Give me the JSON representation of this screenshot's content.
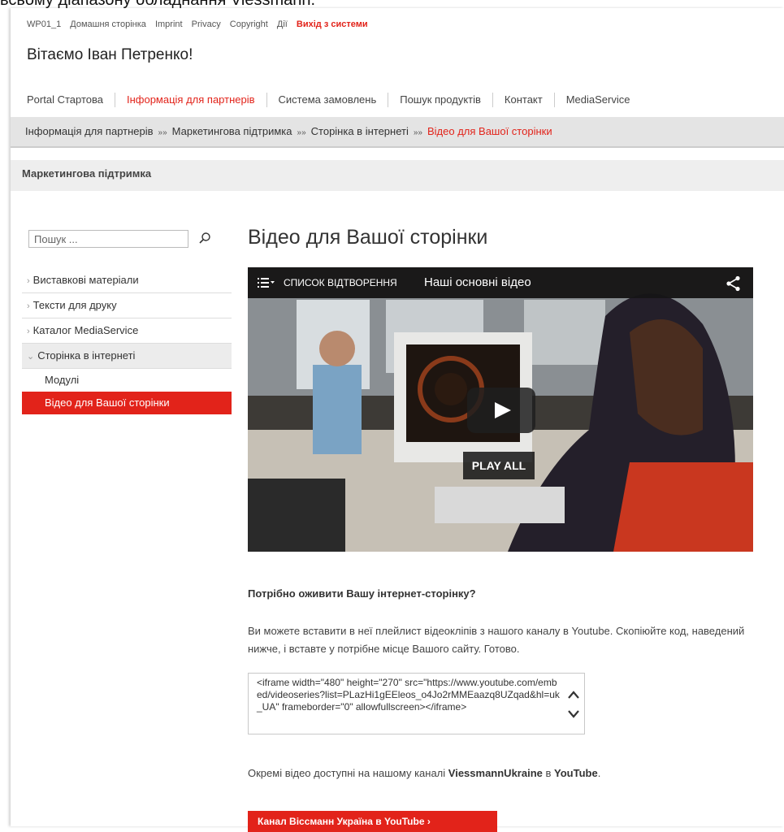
{
  "caption": "всьому діапазону обладнання Viessmann.",
  "utility_links": [
    "WP01_1",
    "Домашня сторінка",
    "Imprint",
    "Privacy",
    "Copyright",
    "Дії",
    "Вихід з системи"
  ],
  "welcome": "Вітаємо Іван Петренко!",
  "main_nav": [
    {
      "label": "Portal Стартова"
    },
    {
      "label": "Інформація для партнерів",
      "active": true
    },
    {
      "label": "Система замовлень"
    },
    {
      "label": "Пошук продуктів"
    },
    {
      "label": "Контакт"
    },
    {
      "label": "MediaService"
    }
  ],
  "breadcrumb": [
    "Інформація для партнерів",
    "Маркетингова підтримка",
    "Сторінка в інтернеті",
    "Відео для Вашої сторінки"
  ],
  "breadcrumb_sep": "»»",
  "section_header": "Маркетингова підтримка",
  "search": {
    "placeholder": "Пошук ..."
  },
  "side_nav": {
    "items": [
      "Виставкові матеріали",
      "Тексти для друку",
      "Каталог MediaService",
      "Сторінка в інтернеті"
    ],
    "sub_items": [
      "Модулі",
      "Відео для Вашої сторінки"
    ]
  },
  "content": {
    "title": "Відео для Вашої сторінки",
    "video": {
      "playlist_label": "СПИСОК ВІДТВОРЕННЯ",
      "title": "Наші основні відео",
      "play_all": "PLAY ALL"
    },
    "subheading": "Потрібно оживити Вашу інтернет-сторінку?",
    "paragraph": "Ви можете вставити в неї плейлист відеокліпів з нашого каналу в Youtube. Скопіюйте код, наведений нижче, і вставте у потрібне місце Вашого сайту. Готово.",
    "embed_code": "<iframe width=\"480\" height=\"270\" src=\"https://www.youtube.com/embed/videoseries?list=PLazHi1gEEleos_o4Jo2rMMEaazq8UZqad&hl=uk_UA\" frameborder=\"0\" allowfullscreen></iframe>",
    "para2_prefix": "Окремі відео доступні на нашому каналі ",
    "para2_channel": "ViessmannUkraine",
    "para2_mid": " в ",
    "para2_youtube": "YouTube",
    "para2_suffix": ".",
    "channel_button": "Канал Віссманн Україна в YouTube"
  },
  "colors": {
    "accent": "#e2231a",
    "breadcrumb_bg": "#e4e4e4"
  }
}
